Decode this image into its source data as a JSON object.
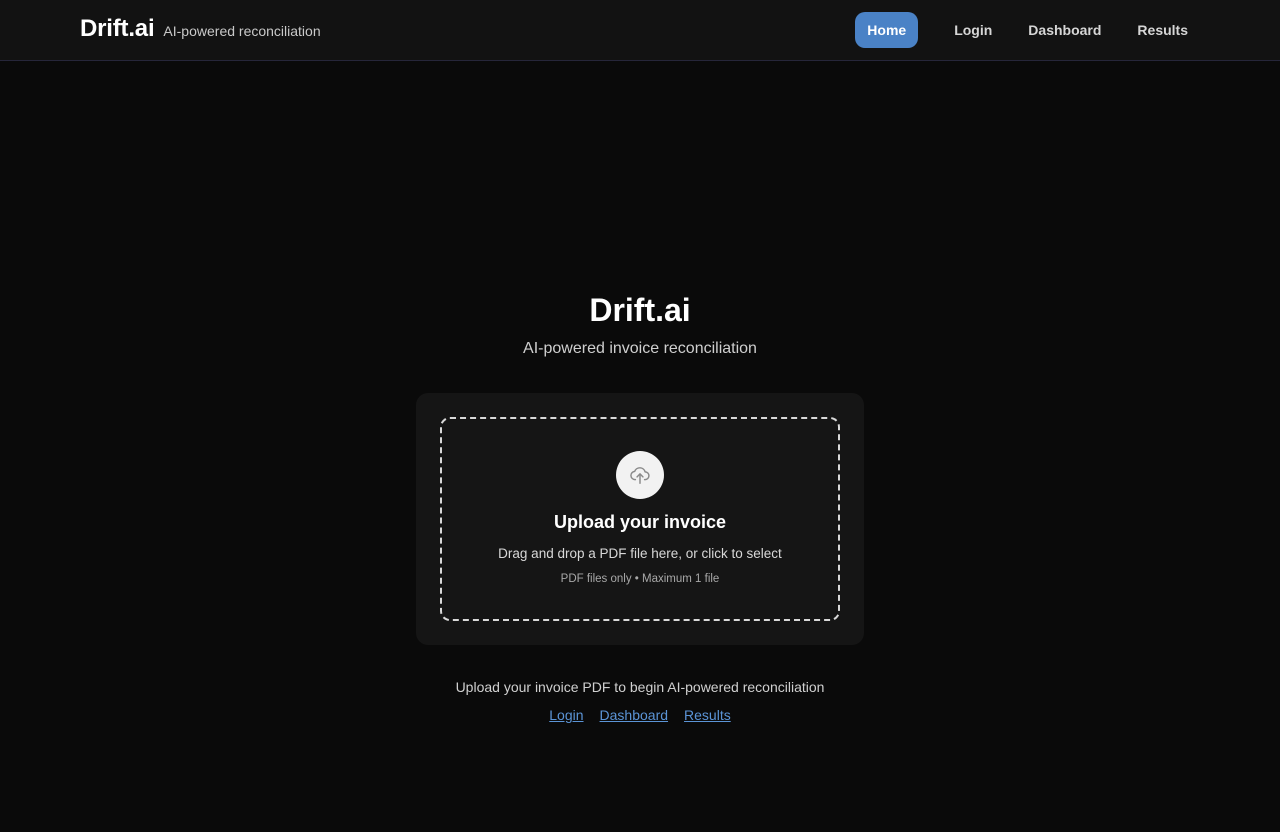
{
  "header": {
    "brand_name": "Drift.ai",
    "brand_tagline": "AI-powered reconciliation",
    "nav": [
      {
        "label": "Home",
        "active": true
      },
      {
        "label": "Login"
      },
      {
        "label": "Dashboard"
      },
      {
        "label": "Results"
      }
    ]
  },
  "hero": {
    "title": "Drift.ai",
    "subtitle": "AI-powered invoice reconciliation"
  },
  "upload": {
    "icon": "cloud-upload-icon",
    "title": "Upload your invoice",
    "description": "Drag and drop a PDF file here, or click to select",
    "hint": "PDF files only • Maximum 1 file"
  },
  "footer": {
    "text": "Upload your invoice PDF to begin AI-powered reconciliation",
    "links": [
      "Login",
      "Dashboard",
      "Results"
    ]
  },
  "colors": {
    "accent": "#4a82c6",
    "link": "#5b94d6",
    "background": "#0a0a0a",
    "card": "#151515"
  }
}
